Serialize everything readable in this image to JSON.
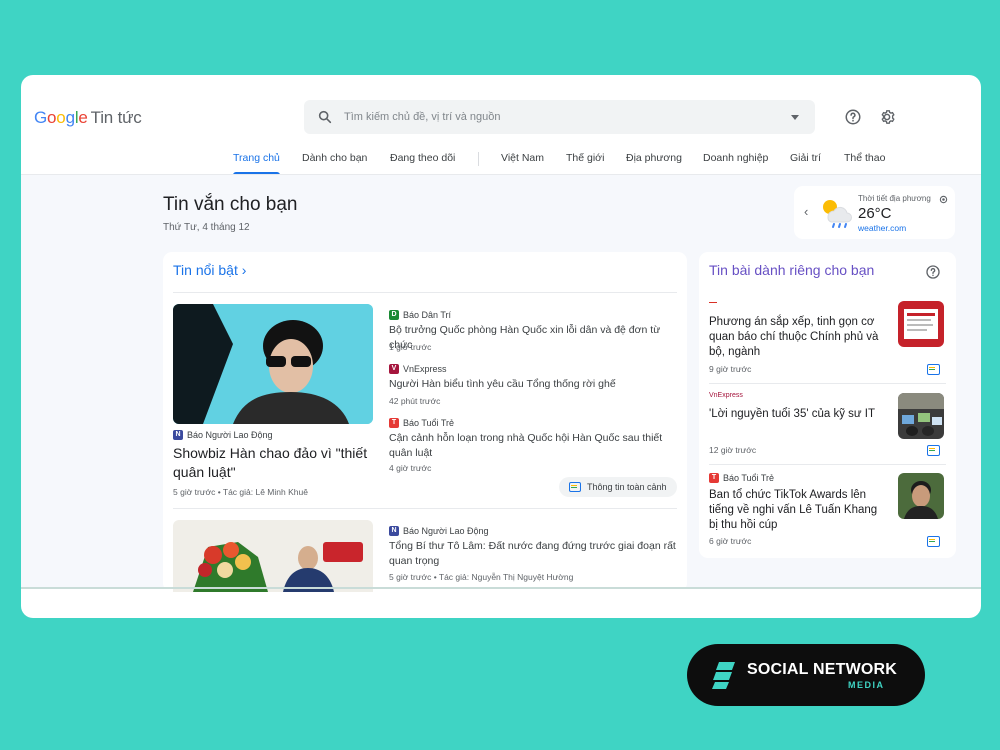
{
  "app": {
    "logo_google": "Google",
    "logo_service": "Tin tức"
  },
  "search": {
    "placeholder": "Tìm kiếm chủ đề, vị trí và nguồn"
  },
  "nav": {
    "tabs": [
      {
        "label": "Trang chủ",
        "active": true
      },
      {
        "label": "Dành cho bạn"
      },
      {
        "label": "Đang theo dõi"
      },
      {
        "label": "Việt Nam"
      },
      {
        "label": "Thế giới"
      },
      {
        "label": "Địa phương"
      },
      {
        "label": "Doanh nghiệp"
      },
      {
        "label": "Giải trí"
      },
      {
        "label": "Thể thao"
      }
    ]
  },
  "briefing": {
    "title": "Tin vắn cho bạn",
    "date": "Thứ Tư, 4 tháng 12"
  },
  "weather": {
    "label": "Thời tiết địa phương",
    "temperature": "26°C",
    "source": "weather.com"
  },
  "top_stories": {
    "heading": "Tin nổi bật",
    "main_story": {
      "source": "Báo Người Lao Động",
      "headline": "Showbiz Hàn chao đảo vì \"thiết quân luật\"",
      "meta": "5 giờ trước • Tác giả: Lê Minh Khuê"
    },
    "related": [
      {
        "source": "Báo Dân Trí",
        "headline": "Bộ trưởng Quốc phòng Hàn Quốc xin lỗi dân và đệ đơn từ chức",
        "time": "1 giờ trước"
      },
      {
        "source": "VnExpress",
        "headline": "Người Hàn biểu tình yêu cầu Tổng thống rời ghế",
        "time": "42 phút trước"
      },
      {
        "source": "Báo Tuổi Trẻ",
        "headline": "Cận cảnh hỗn loạn trong nhà Quốc hội Hàn Quốc sau thiết quân luật",
        "time": "4 giờ trước"
      }
    ],
    "full_coverage": "Thông tin toàn cảnh",
    "second_story": {
      "source": "Báo Người Lao Động",
      "headline": "Tổng Bí thư Tô Lâm: Đất nước đang đứng trước giai đoạn rất quan trọng",
      "meta": "5 giờ trước • Tác giả: Nguyễn Thị Nguyệt Hường"
    }
  },
  "for_you": {
    "heading": "Tin bài dành riêng cho bạn",
    "items": [
      {
        "source": "",
        "headline": "Phương án sắp xếp, tinh gọn cơ quan báo chí thuộc Chính phủ và bộ, ngành",
        "time": "9 giờ trước"
      },
      {
        "source": "VnExpress",
        "headline": "'Lời nguyền tuổi 35' của kỹ sư IT",
        "time": "12 giờ trước"
      },
      {
        "source": "Báo Tuổi Trẻ",
        "headline": "Ban tổ chức TikTok Awards lên tiếng về nghi vấn Lê Tuấn Khang bị thu hồi cúp",
        "time": "6 giờ trước"
      }
    ]
  },
  "brand": {
    "name": "SOCIAL NETWORK",
    "sub": "MEDIA"
  },
  "colors": {
    "background": "#3fd4c4",
    "accent": "#1a73e8",
    "for_you_heading": "#6750c4"
  }
}
